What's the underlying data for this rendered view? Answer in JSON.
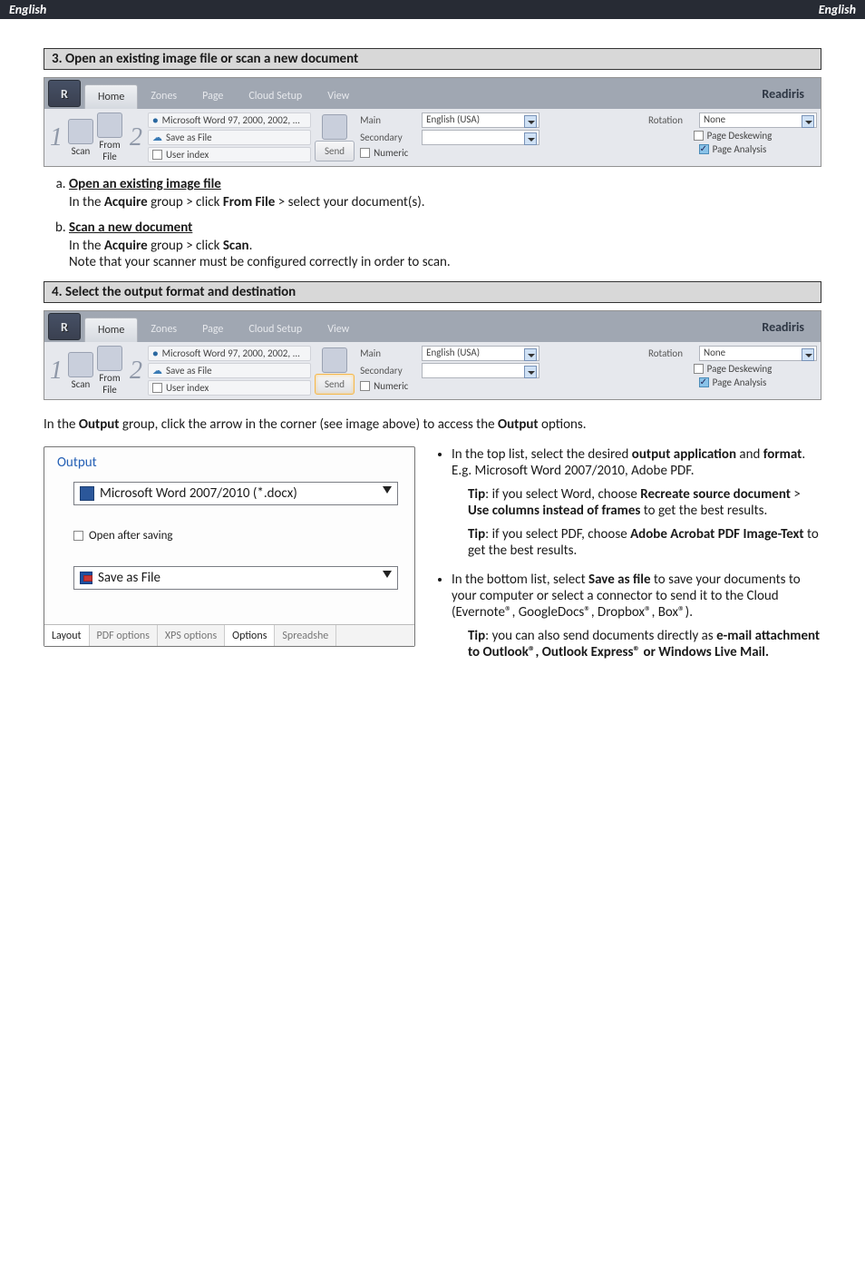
{
  "header": {
    "left": "English",
    "right": "English"
  },
  "sections": {
    "s3": "3. Open an existing image file or scan a new document",
    "s4": "4. Select the output format and destination"
  },
  "ribbon": {
    "brand": "Readiris",
    "tabs": [
      "Home",
      "Zones",
      "Page",
      "Cloud Setup",
      "View"
    ],
    "acquire": {
      "scan": "Scan",
      "fromfile": "From\nFile"
    },
    "output": {
      "line1": "Microsoft Word 97, 2000, 2002, ...",
      "line2": "Save as File",
      "line3": "User index",
      "send": "Send"
    },
    "lang": {
      "main_label": "Main",
      "main_value": "English (USA)",
      "secondary_label": "Secondary",
      "numeric_label": "Numeric"
    },
    "props": {
      "rotation_label": "Rotation",
      "rotation_value": "None",
      "deskew_label": "Page Deskewing",
      "analysis_label": "Page Analysis"
    }
  },
  "steps": {
    "a_head": "Open an existing image file",
    "a_pre": "In the ",
    "a_bold1": "Acquire",
    "a_mid": " group > click ",
    "a_bold2": "From File",
    "a_post": " > select your document(s).",
    "b_head": "Scan a new document",
    "b_pre": "In the ",
    "b_mid": " group > click ",
    "b_bold": "Scan",
    "b_note": "Note that your scanner must be configured correctly in order to scan."
  },
  "para_pre": "In the ",
  "para_bold": "Output",
  "para_mid": " group, click the arrow in the corner (see image above) to access the ",
  "para_post": " options.",
  "dialog": {
    "title": "Output",
    "format_label": "Microsoft Word 2007/2010 (*.docx)",
    "open_after": "Open after saving",
    "save_as": "Save as File",
    "tabs": [
      "Layout",
      "PDF options",
      "XPS options",
      "Options",
      "Spreadshe"
    ]
  },
  "right": {
    "b1_a": "In the top list, select the desired ",
    "b1_b": "output application",
    "b1_c": " and ",
    "b1_d": "format",
    "b1_e": ". E.g. Microsoft Word 2007/2010, Adobe PDF.",
    "tip1_a": "Tip",
    "tip1_b": ": if you select Word, choose ",
    "tip1_c": "Recreate source document",
    "tip1_d": " > ",
    "tip1_e": "Use columns instead of frames",
    "tip1_f": " to get the best results.",
    "tip2_a": "Tip",
    "tip2_b": ": if you select PDF, choose ",
    "tip2_c": "Adobe Acrobat PDF Image-Text",
    "tip2_d": " to get the best results.",
    "b2_a": "In the bottom list, select ",
    "b2_b": "Save as file",
    "b2_c": " to save your documents to your computer or select a connector to send it to the Cloud (Evernote®, GoogleDocs®, Dropbox®, Box®).",
    "tip3_a": "Tip",
    "tip3_b": ": you can also send documents directly as ",
    "tip3_c": "e-mail attachment to Outlook®, Outlook Express® or Windows Live Mail."
  }
}
